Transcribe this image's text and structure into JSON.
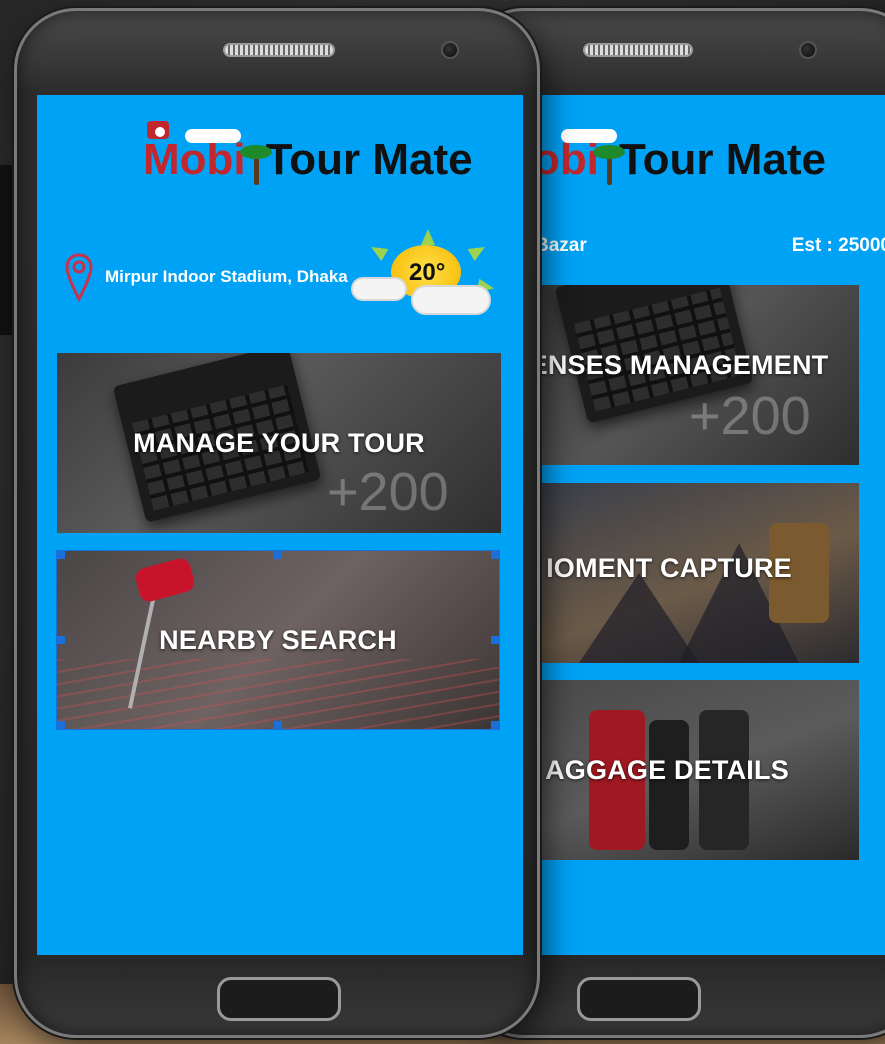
{
  "app": {
    "logo_mobi": "Mobi",
    "logo_tour_mate": "Tour Mate"
  },
  "left_screen": {
    "location": "Mirpur Indoor Stadium, Dhaka",
    "temperature": "20°",
    "cards": [
      {
        "label": "MANAGE YOUR TOUR",
        "overlay": "+200"
      },
      {
        "label": "NEARBY SEARCH"
      }
    ]
  },
  "right_screen": {
    "logo_partial": "obi",
    "place_partial": "Bazar",
    "estimate": "Est : 25000",
    "cards": [
      {
        "label": "ENSES MANAGEMENT",
        "overlay": "+200"
      },
      {
        "label": "IOMENT CAPTURE"
      },
      {
        "label": "AGGAGE DETAILS"
      }
    ]
  },
  "colors": {
    "screen_bg": "#00a2f6",
    "logo_red": "#c1272d",
    "logo_dark": "#111111",
    "phone_body": "#2c2c2c"
  }
}
